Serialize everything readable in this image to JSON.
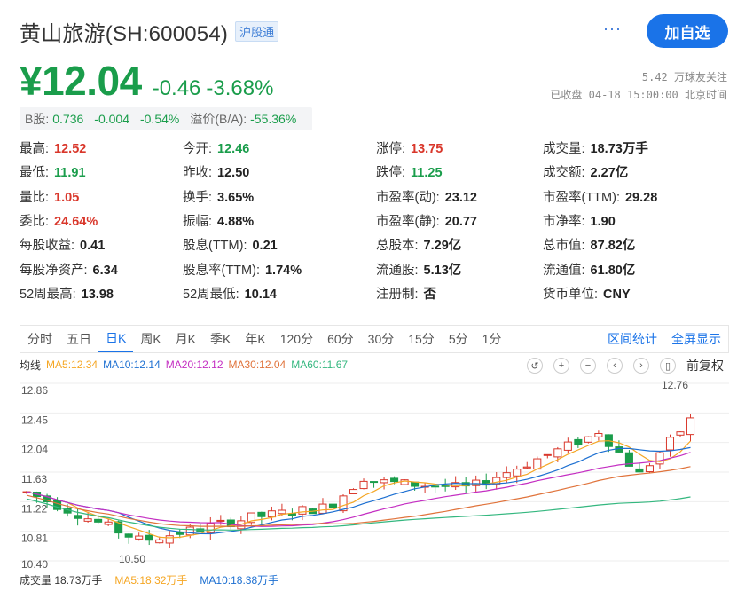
{
  "header": {
    "name": "黄山旅游(SH:600054)",
    "badge": "沪股通",
    "more": "···",
    "add_label": "加自选"
  },
  "quote": {
    "price": "¥12.04",
    "change": "-0.46",
    "change_pct": "-3.68%",
    "followers": "5.42 万球友关注",
    "status": "已收盘 04-18 15:00:00 北京时间"
  },
  "b_share": {
    "label": "B股:",
    "price": "0.736",
    "change": "-0.004",
    "pct": "-0.54%",
    "premium_label": "溢价(B/A):",
    "premium": "-55.36%"
  },
  "stats": [
    {
      "label": "最高:",
      "value": "12.52",
      "tone": "red"
    },
    {
      "label": "今开:",
      "value": "12.46",
      "tone": "green"
    },
    {
      "label": "涨停:",
      "value": "13.75",
      "tone": "red"
    },
    {
      "label": "成交量:",
      "value": "18.73万手",
      "tone": "dark"
    },
    {
      "label": "最低:",
      "value": "11.91",
      "tone": "green"
    },
    {
      "label": "昨收:",
      "value": "12.50",
      "tone": "dark"
    },
    {
      "label": "跌停:",
      "value": "11.25",
      "tone": "green"
    },
    {
      "label": "成交额:",
      "value": "2.27亿",
      "tone": "dark"
    },
    {
      "label": "量比:",
      "value": "1.05",
      "tone": "red"
    },
    {
      "label": "换手:",
      "value": "3.65%",
      "tone": "dark"
    },
    {
      "label": "市盈率(动):",
      "value": "23.12",
      "tone": "dark"
    },
    {
      "label": "市盈率(TTM):",
      "value": "29.28",
      "tone": "dark"
    },
    {
      "label": "委比:",
      "value": "24.64%",
      "tone": "red"
    },
    {
      "label": "振幅:",
      "value": "4.88%",
      "tone": "dark"
    },
    {
      "label": "市盈率(静):",
      "value": "20.77",
      "tone": "dark"
    },
    {
      "label": "市净率:",
      "value": "1.90",
      "tone": "dark"
    },
    {
      "label": "每股收益:",
      "value": "0.41",
      "tone": "dark"
    },
    {
      "label": "股息(TTM):",
      "value": "0.21",
      "tone": "dark"
    },
    {
      "label": "总股本:",
      "value": "7.29亿",
      "tone": "dark"
    },
    {
      "label": "总市值:",
      "value": "87.82亿",
      "tone": "dark"
    },
    {
      "label": "每股净资产:",
      "value": "6.34",
      "tone": "dark"
    },
    {
      "label": "股息率(TTM):",
      "value": "1.74%",
      "tone": "dark"
    },
    {
      "label": "流通股:",
      "value": "5.13亿",
      "tone": "dark"
    },
    {
      "label": "流通值:",
      "value": "61.80亿",
      "tone": "dark"
    },
    {
      "label": "52周最高:",
      "value": "13.98",
      "tone": "dark"
    },
    {
      "label": "52周最低:",
      "value": "10.14",
      "tone": "dark"
    },
    {
      "label": "注册制:",
      "value": "否",
      "tone": "dark"
    },
    {
      "label": "货币单位:",
      "value": "CNY",
      "tone": "dark"
    }
  ],
  "tabs": [
    "分时",
    "五日",
    "日K",
    "周K",
    "月K",
    "季K",
    "年K",
    "120分",
    "60分",
    "30分",
    "15分",
    "5分",
    "1分"
  ],
  "active_tab": "日K",
  "tab_actions": [
    "区间统计",
    "全屏显示"
  ],
  "ma": {
    "label": "均线",
    "ma5": "MA5:12.34",
    "ma10": "MA10:12.14",
    "ma20": "MA20:12.12",
    "ma30": "MA30:12.04",
    "ma60": "MA60:11.67",
    "fq": "前复权"
  },
  "colors": {
    "up": "#d9372b",
    "down": "#1a9d4b",
    "ma5": "#f5a623",
    "ma10": "#1c6fd1",
    "ma20": "#c42ec2",
    "ma30": "#e0733b",
    "ma60": "#34b77f"
  },
  "chart_data": {
    "type": "candlestick",
    "y_ticks": [
      "12.86",
      "12.45",
      "12.04",
      "11.63",
      "11.22",
      "10.81",
      "10.40"
    ],
    "ylim": [
      10.4,
      12.86
    ],
    "high_label": "12.76",
    "low_label": "10.50"
  },
  "volume": {
    "label": "成交量 18.73万手",
    "ma5": "MA5:18.32万手",
    "ma10": "MA10:18.38万手"
  }
}
